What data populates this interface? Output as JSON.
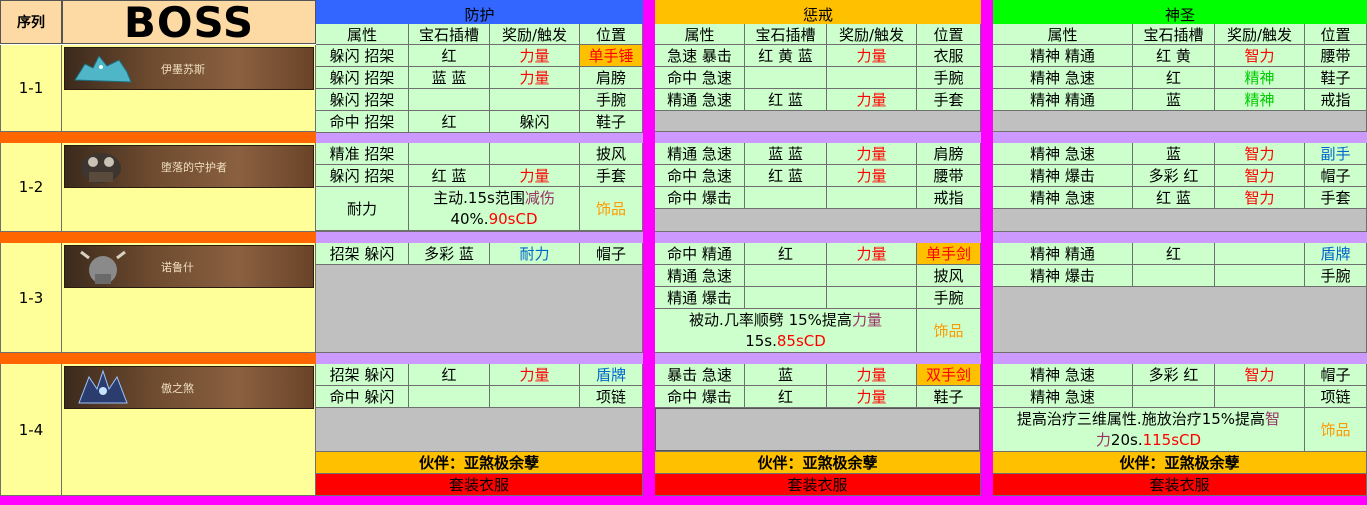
{
  "header": {
    "seq": "序列",
    "boss": "BOSS",
    "sections": [
      "防护",
      "惩戒",
      "神圣"
    ],
    "cols": [
      "属性",
      "宝石插槽",
      "奖励/触发",
      "位置"
    ]
  },
  "colors": {
    "red": "#ff0000",
    "green": "#00cc00",
    "blue": "#0066cc",
    "orange": "#ff9900",
    "maroon": "#993366",
    "accent_gold": "#ffc000",
    "accent_blue": "#3366ff",
    "accent_green": "#00ff00",
    "magenta": "#ff00ff"
  },
  "groups": [
    {
      "id": "1-1",
      "boss_name": "伊墨苏斯",
      "boss_icon": "ice-beast-portrait",
      "prot": [
        [
          "躲闪 招架",
          "红",
          "力量",
          "单手锤"
        ],
        [
          "躲闪 招架",
          "蓝 蓝",
          "力量",
          "肩膀"
        ],
        [
          "躲闪 招架",
          "",
          "",
          "手腕"
        ],
        [
          "命中 招架",
          "红",
          "躲闪",
          "鞋子"
        ]
      ],
      "ret": [
        [
          "急速 暴击",
          "红 黄 蓝",
          "力量",
          "衣服"
        ],
        [
          "命中 急速",
          "",
          "",
          "手腕"
        ],
        [
          "精通 急速",
          "红 蓝",
          "力量",
          "手套"
        ]
      ],
      "holy": [
        [
          "精神 精通",
          "红 黄",
          "智力",
          "腰带"
        ],
        [
          "精神 急速",
          "红",
          "精神",
          "鞋子"
        ],
        [
          "精神 精通",
          "蓝",
          "精神",
          "戒指"
        ]
      ]
    },
    {
      "id": "1-2",
      "boss_name": "堕落的守护者",
      "boss_icon": "pandaren-warrior-portrait",
      "prot": [
        [
          "精准 招架",
          "",
          "",
          "披风"
        ],
        [
          "躲闪 招架",
          "红 蓝",
          "力量",
          "手套"
        ]
      ],
      "prot_trinket": {
        "stat": "耐力",
        "text_a": "主动.15s范围",
        "text_b": "减伤",
        "text_c": "40%.",
        "text_d": "90sCD",
        "slot": "饰品"
      },
      "ret": [
        [
          "精通 急速",
          "蓝 蓝",
          "力量",
          "肩膀"
        ],
        [
          "命中 急速",
          "红 蓝",
          "力量",
          "腰带"
        ],
        [
          "命中 爆击",
          "",
          "",
          "戒指"
        ]
      ],
      "holy": [
        [
          "精神 急速",
          "蓝",
          "智力",
          "副手"
        ],
        [
          "精神 爆击",
          "多彩 红",
          "智力",
          "帽子"
        ],
        [
          "精神 急速",
          "红 蓝",
          "智力",
          "手套"
        ]
      ]
    },
    {
      "id": "1-3",
      "boss_name": "诺鲁什",
      "boss_icon": "tauren-portrait",
      "prot": [
        [
          "招架 躲闪",
          "多彩 蓝",
          "耐力",
          "帽子"
        ]
      ],
      "ret": [
        [
          "命中 精通",
          "红",
          "力量",
          "单手剑"
        ],
        [
          "精通 急速",
          "",
          "",
          "披风"
        ],
        [
          "精通 爆击",
          "",
          "",
          "手腕"
        ]
      ],
      "ret_trinket": {
        "text_a": "被动.几率顺劈 15%提高",
        "text_b": "力量",
        "text_c": "15s.",
        "text_d": "85sCD",
        "slot": "饰品"
      },
      "holy": [
        [
          "精神 精通",
          "红",
          "",
          "盾牌"
        ],
        [
          "精神 爆击",
          "",
          "",
          "手腕"
        ]
      ]
    },
    {
      "id": "1-4",
      "boss_name": "傲之煞",
      "boss_icon": "sha-of-pride-portrait",
      "prot": [
        [
          "招架 躲闪",
          "红",
          "力量",
          "盾牌"
        ],
        [
          "命中 躲闪",
          "",
          "",
          "项链"
        ]
      ],
      "ret": [
        [
          "暴击 急速",
          "蓝",
          "力量",
          "双手剑"
        ],
        [
          "命中 爆击",
          "红",
          "力量",
          "鞋子"
        ]
      ],
      "holy": [
        [
          "精神 急速",
          "多彩 红",
          "智力",
          "帽子"
        ],
        [
          "精神 急速",
          "",
          "",
          "项链"
        ]
      ],
      "holy_trinket": {
        "text_a": "提高治疗三维属性.施放治疗15%提高",
        "text_b": "智",
        "text_c": "力",
        "text_d": "20s.",
        "text_e": "115sCD",
        "slot": "饰品"
      },
      "companion": "伙伴：亚煞极余孽",
      "set": "套装衣服"
    }
  ]
}
